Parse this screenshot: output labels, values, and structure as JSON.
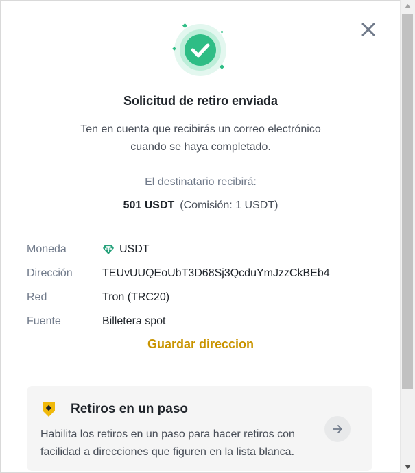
{
  "dialog": {
    "title": "Solicitud de retiro enviada",
    "subtitle_line1": "Ten en cuenta que recibirás un correo electrónico",
    "subtitle_line2": "cuando se haya completado.",
    "receive_label": "El destinatario recibirá:",
    "receive_amount": "501 USDT",
    "receive_fee": "(Comisión: 1 USDT)",
    "close_icon": "close-icon",
    "success_icon": "check-circle-icon"
  },
  "details": [
    {
      "label": "Moneda",
      "value": "USDT",
      "icon": "tether-icon"
    },
    {
      "label": "Dirección",
      "value": "TEUvUUQEoUbT3D68Sj3QcduYmJzzCkBEb4"
    },
    {
      "label": "Red",
      "value": "Tron (TRC20)"
    },
    {
      "label": "Fuente",
      "value": "Billetera spot"
    }
  ],
  "save_address_label": "Guardar direccion",
  "promo": {
    "title": "Retiros en un paso",
    "description": "Habilita los retiros en un paso para hacer retiros con facilidad a direcciones que figuren en la lista blanca.",
    "icon": "shield-icon",
    "arrow_icon": "arrow-right-icon"
  },
  "colors": {
    "accent": "#c99400",
    "success": "#2ebd85",
    "tether": "#26a17b",
    "shield": "#f0b90b"
  }
}
